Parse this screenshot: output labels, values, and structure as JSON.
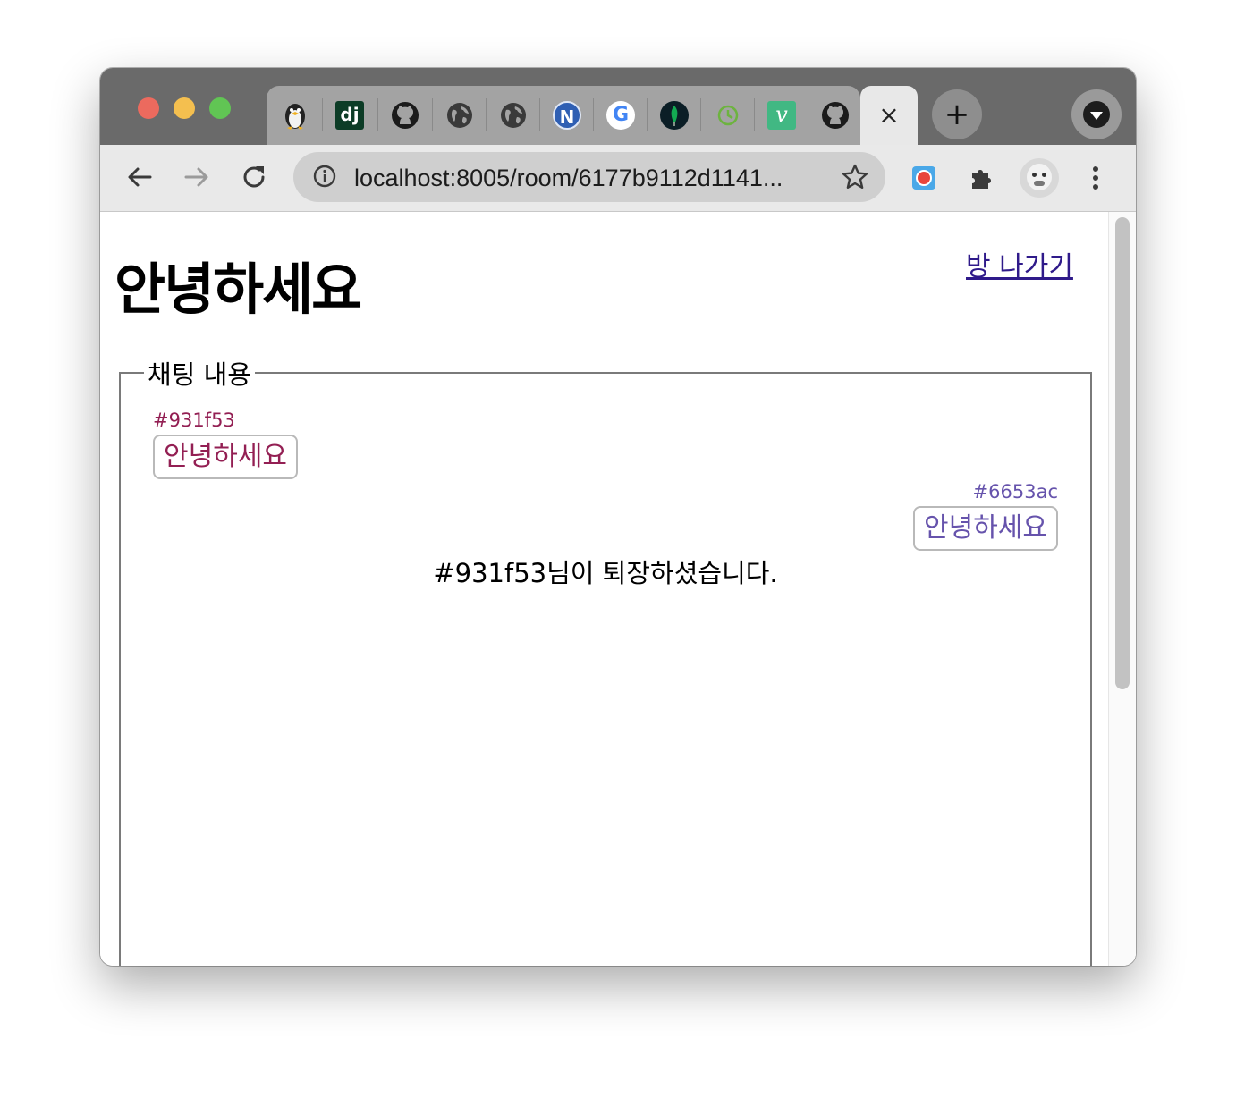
{
  "browser": {
    "tabs": [
      {
        "icon": "penguin-icon",
        "color": "#2b2b2b"
      },
      {
        "icon": "django-icon",
        "text": "dj",
        "color": "#0c4b33"
      },
      {
        "icon": "github-icon",
        "color": "#1b1b1b"
      },
      {
        "icon": "globe-icon",
        "color": "#3a3a3a"
      },
      {
        "icon": "globe-icon",
        "color": "#3a3a3a"
      },
      {
        "icon": "naver-icon",
        "text": "N",
        "color": "#2f5fb3"
      },
      {
        "icon": "google-icon",
        "text": "G",
        "color": "#4285f4"
      },
      {
        "icon": "mongodb-icon",
        "color": "#13aa52"
      },
      {
        "icon": "leaf-clock-icon",
        "color": "#6db33f"
      },
      {
        "icon": "vue-icon",
        "text": "v",
        "color": "#41b883"
      },
      {
        "icon": "github-icon",
        "color": "#1b1b1b"
      }
    ],
    "active_tab_close": "×",
    "new_tab": "+",
    "url": "localhost:8005/room/6177b9112d1141..."
  },
  "page": {
    "title": "안녕하세요",
    "leave_label": "방 나가기",
    "legend": "채팅 내용"
  },
  "chat": {
    "messages": [
      {
        "sender": "#931f53",
        "text": "안녕하세요",
        "color": "#931f53",
        "side": "left"
      },
      {
        "sender": "#6653ac",
        "text": "안녕하세요",
        "color": "#6653ac",
        "side": "right"
      }
    ],
    "system": "#931f53님이 퇴장하셨습니다."
  }
}
